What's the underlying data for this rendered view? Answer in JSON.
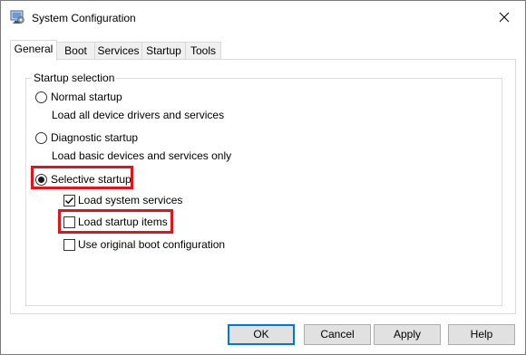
{
  "window": {
    "title": "System Configuration",
    "app_icon": "msconfig-icon",
    "close_icon": "close-icon"
  },
  "tabs": [
    {
      "label": "General",
      "active": true
    },
    {
      "label": "Boot",
      "active": false
    },
    {
      "label": "Services",
      "active": false
    },
    {
      "label": "Startup",
      "active": false
    },
    {
      "label": "Tools",
      "active": false
    }
  ],
  "startup_selection": {
    "legend": "Startup selection",
    "normal": {
      "label": "Normal startup",
      "description": "Load all device drivers and services",
      "selected": false
    },
    "diagnostic": {
      "label": "Diagnostic startup",
      "description": "Load basic devices and services only",
      "selected": false
    },
    "selective": {
      "label": "Selective startup",
      "selected": true,
      "options": {
        "load_system_services": {
          "label": "Load system services",
          "checked": true
        },
        "load_startup_items": {
          "label": "Load startup items",
          "checked": false
        },
        "use_original_boot": {
          "label": "Use original boot configuration",
          "checked": false
        }
      }
    }
  },
  "highlight_color": "#e2141a",
  "buttons": {
    "ok": "OK",
    "cancel": "Cancel",
    "apply": "Apply",
    "help": "Help"
  }
}
